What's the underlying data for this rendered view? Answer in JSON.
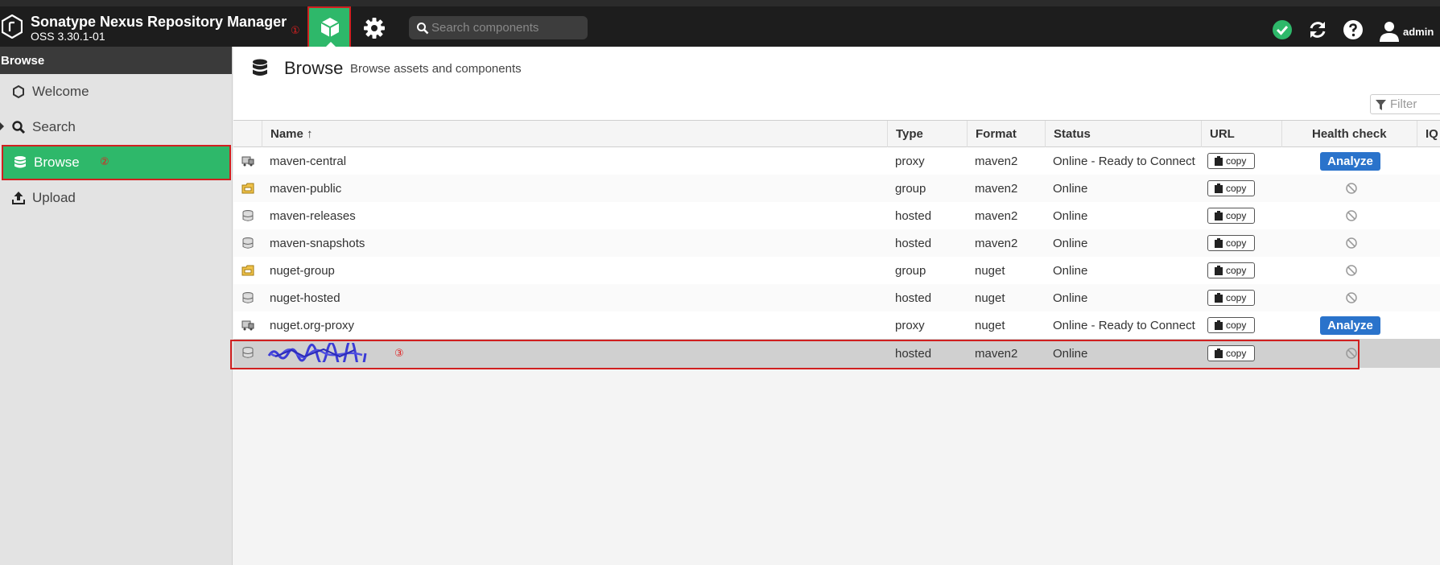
{
  "header": {
    "app_title": "Sonatype Nexus Repository Manager",
    "app_version": "OSS 3.30.1-01",
    "annotation_1": "①",
    "search_placeholder": "Search components",
    "user_name": "admin"
  },
  "sidebar": {
    "header": "Browse",
    "items": [
      {
        "label": "Welcome",
        "icon": "hexagon-icon"
      },
      {
        "label": "Search",
        "icon": "search-icon"
      },
      {
        "label": "Browse",
        "icon": "database-icon",
        "annotation": "②"
      },
      {
        "label": "Upload",
        "icon": "upload-icon"
      }
    ]
  },
  "main": {
    "title": "Browse",
    "subtitle": "Browse assets and components",
    "filter_placeholder": "Filter",
    "columns": {
      "name": "Name ↑",
      "type": "Type",
      "format": "Format",
      "status": "Status",
      "url": "URL",
      "health": "Health check",
      "iq": "IQ"
    },
    "copy_label": "copy",
    "analyze_label": "Analyze",
    "annotation_3": "③",
    "rows": [
      {
        "name": "maven-central",
        "type": "proxy",
        "format": "maven2",
        "status": "Online - Ready to Connect",
        "health": "analyze"
      },
      {
        "name": "maven-public",
        "type": "group",
        "format": "maven2",
        "status": "Online",
        "health": "na"
      },
      {
        "name": "maven-releases",
        "type": "hosted",
        "format": "maven2",
        "status": "Online",
        "health": "na"
      },
      {
        "name": "maven-snapshots",
        "type": "hosted",
        "format": "maven2",
        "status": "Online",
        "health": "na"
      },
      {
        "name": "nuget-group",
        "type": "group",
        "format": "nuget",
        "status": "Online",
        "health": "na"
      },
      {
        "name": "nuget-hosted",
        "type": "hosted",
        "format": "nuget",
        "status": "Online",
        "health": "na"
      },
      {
        "name": "nuget.org-proxy",
        "type": "proxy",
        "format": "nuget",
        "status": "Online - Ready to Connect",
        "health": "analyze"
      },
      {
        "name": "",
        "type": "hosted",
        "format": "maven2",
        "status": "Online",
        "health": "na"
      }
    ]
  },
  "colors": {
    "accent_green": "#2eb86a",
    "analyze_blue": "#2a73cb",
    "annotation_red": "#d02020",
    "topbar": "#1d1d1d"
  }
}
